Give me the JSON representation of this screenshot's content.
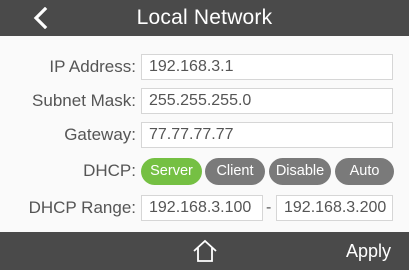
{
  "header": {
    "title": "Local Network",
    "back_icon": "chevron-left-icon"
  },
  "form": {
    "ip_address": {
      "label": "IP Address:",
      "value": "192.168.3.1"
    },
    "subnet_mask": {
      "label": "Subnet Mask:",
      "value": "255.255.255.0"
    },
    "gateway": {
      "label": "Gateway:",
      "value": "77.77.77.77"
    },
    "dhcp": {
      "label": "DHCP:",
      "options": [
        "Server",
        "Client",
        "Disable",
        "Auto"
      ],
      "selected": "Server"
    },
    "dhcp_range": {
      "label": "DHCP Range:",
      "start": "192.168.3.100",
      "separator": "-",
      "end": "192.168.3.200"
    }
  },
  "footer": {
    "home_icon": "home-icon",
    "apply_label": "Apply"
  },
  "colors": {
    "bar": "#4a4a4a",
    "active_segment": "#75c043",
    "inactive_segment": "#7a7a7a"
  }
}
